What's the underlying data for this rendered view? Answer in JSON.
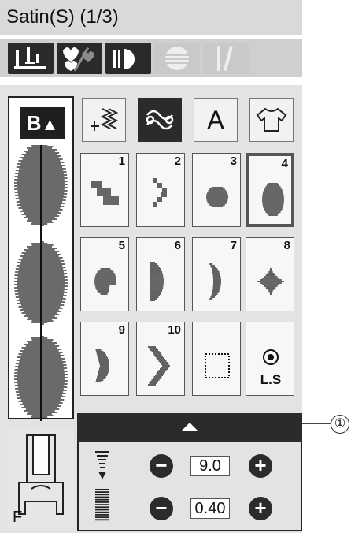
{
  "header": {
    "title": "Satin(S) (1/3)"
  },
  "mode_tabs": [
    {
      "icon": "foot-needle-icon",
      "state": "active"
    },
    {
      "icon": "hearts-mirror-icon",
      "state": "active"
    },
    {
      "icon": "mirror-image-icon",
      "state": "active"
    },
    {
      "icon": "elongation-icon",
      "state": "disabled"
    },
    {
      "icon": "twin-needle-icon",
      "state": "disabled"
    }
  ],
  "preview": {
    "badge_label": "B",
    "badge_icon": "up-arrow-icon"
  },
  "categories": [
    {
      "name": "utility",
      "icon": "utility-stitch-icon",
      "active": false
    },
    {
      "name": "decorative",
      "icon": "satin-stitch-icon",
      "active": true
    },
    {
      "name": "letters",
      "label": "A",
      "active": false
    },
    {
      "name": "garment",
      "icon": "shirt-icon",
      "active": false
    }
  ],
  "stitches": [
    {
      "number": "1",
      "selected": false,
      "shape": "steps"
    },
    {
      "number": "2",
      "selected": false,
      "shape": "zigzag-steps"
    },
    {
      "number": "3",
      "selected": false,
      "shape": "circle"
    },
    {
      "number": "4",
      "selected": true,
      "shape": "oval"
    },
    {
      "number": "5",
      "selected": false,
      "shape": "drop"
    },
    {
      "number": "6",
      "selected": false,
      "shape": "half-disc"
    },
    {
      "number": "7",
      "selected": false,
      "shape": "crescent"
    },
    {
      "number": "8",
      "selected": false,
      "shape": "star"
    },
    {
      "number": "9",
      "selected": false,
      "shape": "arrow-crescent"
    },
    {
      "number": "10",
      "selected": false,
      "shape": "chevron"
    },
    {
      "number": "",
      "selected": false,
      "shape": "dotted-square"
    },
    {
      "number": "",
      "selected": false,
      "shape": "lock-stitch",
      "label": "L.S"
    }
  ],
  "foot": {
    "letter": "F"
  },
  "settings": {
    "width": {
      "value": "9.0",
      "minus": "−",
      "plus": "+"
    },
    "length": {
      "value": "0.40",
      "minus": "−",
      "plus": "+"
    }
  },
  "callout": {
    "label": "①"
  }
}
